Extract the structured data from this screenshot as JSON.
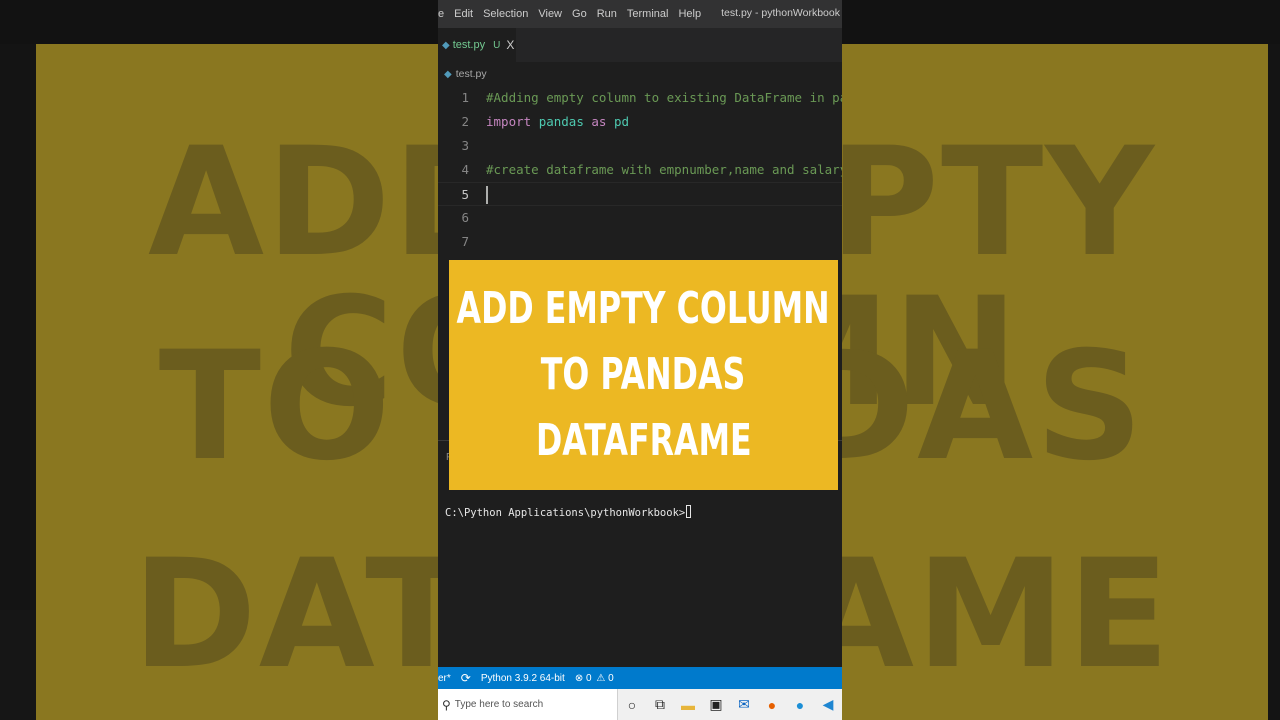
{
  "overlay": {
    "title_lines": [
      "ADD EMPTY COLUMN",
      "TO PANDAS",
      "DATAFRAME"
    ]
  },
  "background_text": [
    "ADD EMPTY COLUMN",
    "TO PANDAS",
    "DATAFRAME"
  ],
  "menubar": {
    "items": [
      "e",
      "Edit",
      "Selection",
      "View",
      "Go",
      "Run",
      "Terminal",
      "Help"
    ],
    "window_title": "test.py - pythonWorkbook"
  },
  "tab": {
    "label": "test.py",
    "modified": "U",
    "close": "X"
  },
  "breadcrumb": {
    "file": "test.py"
  },
  "editor": {
    "active_line": 5,
    "lines": [
      {
        "n": "1",
        "segments": [
          {
            "t": "#Adding empty column to existing DataFrame in pandas",
            "c": "cmt"
          }
        ]
      },
      {
        "n": "2",
        "segments": [
          {
            "t": "import ",
            "c": "kw"
          },
          {
            "t": "pandas ",
            "c": "mod"
          },
          {
            "t": "as ",
            "c": "kw"
          },
          {
            "t": "pd",
            "c": "mod"
          }
        ]
      },
      {
        "n": "3",
        "segments": []
      },
      {
        "n": "4",
        "segments": [
          {
            "t": "#create dataframe with empnumber,name and salary",
            "c": "cmt"
          }
        ]
      },
      {
        "n": "5",
        "segments": []
      },
      {
        "n": "6",
        "segments": []
      },
      {
        "n": "7",
        "segments": []
      }
    ]
  },
  "panel": {
    "tab_letter": "P"
  },
  "terminal": {
    "prompt": "C:\\Python Applications\\pythonWorkbook>"
  },
  "statusbar": {
    "branch": "er*",
    "sync_icon": "⟳",
    "interpreter": "Python 3.9.2 64-bit",
    "errors": "0",
    "warnings": "0"
  },
  "taskbar": {
    "search_placeholder": "Type here to search",
    "icons": [
      "cortana-icon",
      "task-view-icon",
      "file-explorer-icon",
      "store-icon",
      "mail-icon",
      "firefox-icon",
      "edge-icon",
      "vscode-icon"
    ]
  },
  "colors": {
    "accent_yellow": "#ecb823",
    "statusbar_blue": "#007acc",
    "editor_bg": "#1e1e1e"
  }
}
